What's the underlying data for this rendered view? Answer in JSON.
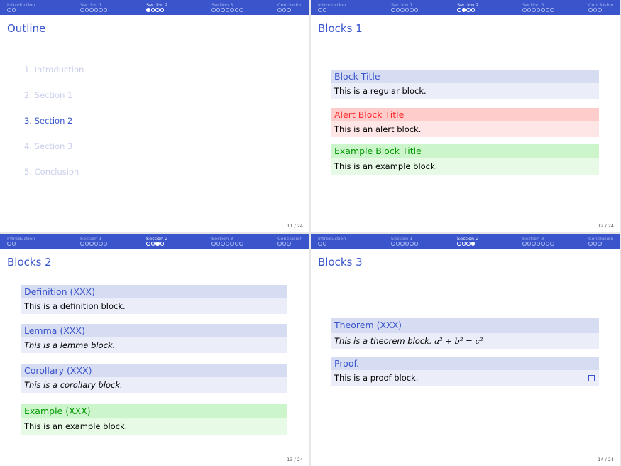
{
  "nav": {
    "sections": [
      "Introduction",
      "Section 1",
      "Section 2",
      "Section 3",
      "Conclusion"
    ],
    "dot_counts": [
      2,
      6,
      4,
      7,
      3
    ]
  },
  "slides": [
    {
      "title": "Outline",
      "page": "11 / 24",
      "active_section": 2,
      "filled_dot": 0,
      "outline": [
        "1. Introduction",
        "2. Section 1",
        "3. Section 2",
        "4. Section 3",
        "5. Conclusion"
      ],
      "current_item": 2
    },
    {
      "title": "Blocks 1",
      "page": "12 / 24",
      "active_section": 2,
      "filled_dot": 1,
      "blocks": [
        {
          "title": "Block Title",
          "body": "This is a regular block."
        },
        {
          "title": "Alert Block Title",
          "body": "This is an alert block."
        },
        {
          "title": "Example Block Title",
          "body": "This is an example block."
        }
      ]
    },
    {
      "title": "Blocks 2",
      "page": "13 / 24",
      "active_section": 2,
      "filled_dot": 2,
      "blocks": [
        {
          "title": "Definition (XXX)",
          "body": "This is a definition block."
        },
        {
          "title": "Lemma (XXX)",
          "body": "This is a lemma block."
        },
        {
          "title": "Corollary (XXX)",
          "body": "This is a corollary block."
        },
        {
          "title": "Example (XXX)",
          "body": "This is an example block."
        }
      ]
    },
    {
      "title": "Blocks 3",
      "page": "14 / 24",
      "active_section": 2,
      "filled_dot": 3,
      "blocks": [
        {
          "title": "Theorem (XXX)",
          "body": "This is a theorem block.",
          "math": "a² + b² = c²"
        },
        {
          "title": "Proof.",
          "body": "This is a proof block."
        }
      ]
    }
  ],
  "colors": {
    "structure": "#3a55cc",
    "alert": "#ff2a2a",
    "example": "#009900"
  }
}
